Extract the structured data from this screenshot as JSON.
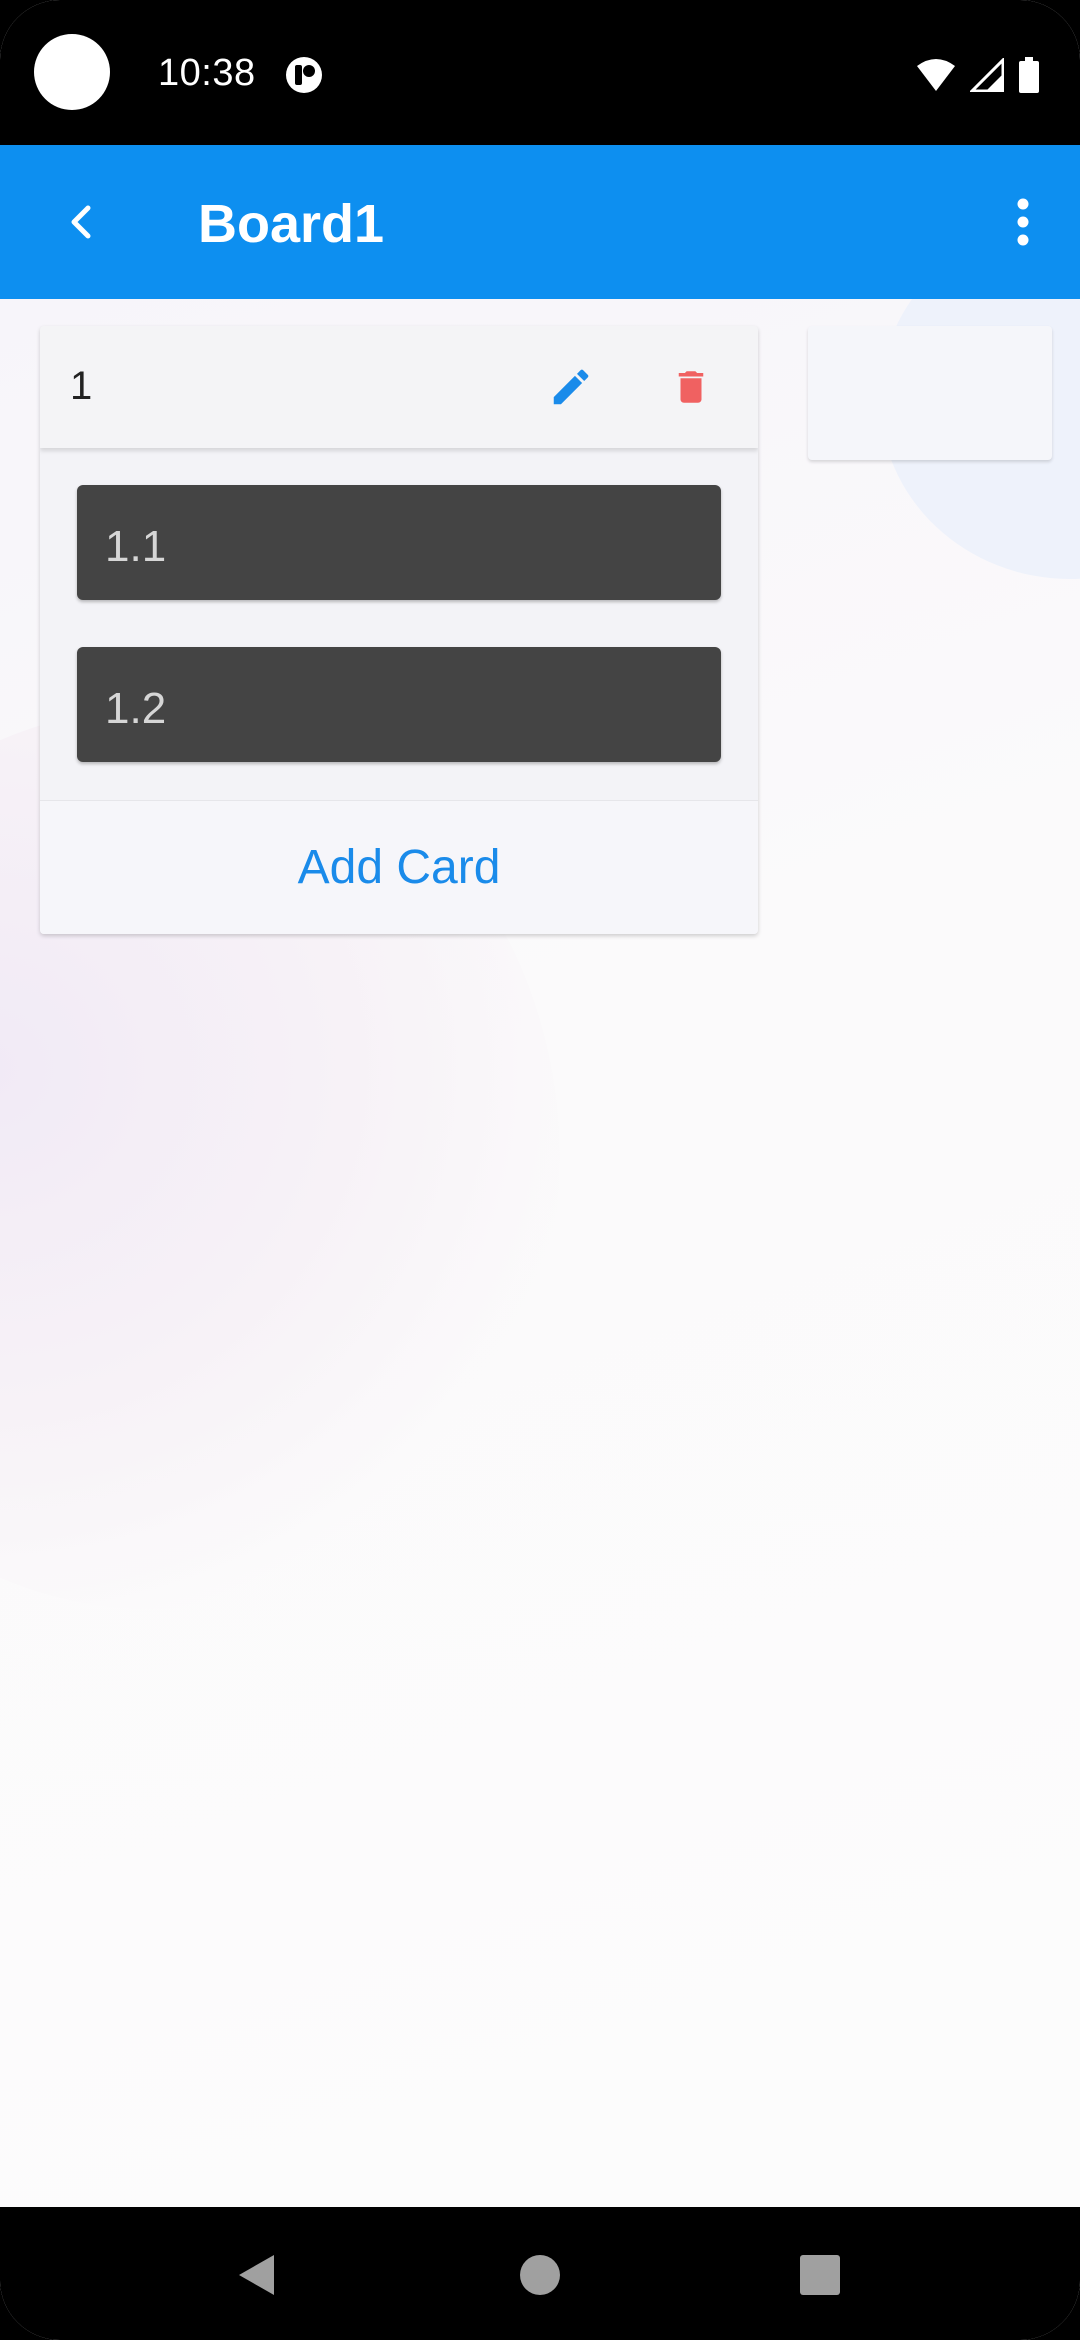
{
  "status_bar": {
    "time": "10:38",
    "icons": [
      "wifi-icon",
      "signal-icon",
      "battery-icon",
      "notification-icon"
    ]
  },
  "app_bar": {
    "title": "Board1",
    "background": "#0d8ff0",
    "back_icon": "chevron-left-icon",
    "menu_icon": "more-vert-icon"
  },
  "board": {
    "lists": [
      {
        "title": "1",
        "edit_icon": "pencil-icon",
        "delete_icon": "trash-icon",
        "cards": [
          {
            "label": "1.1"
          },
          {
            "label": "1.2"
          }
        ],
        "add_card_label": "Add Card"
      }
    ]
  },
  "colors": {
    "accent": "#1a8bea",
    "delete": "#f06161",
    "card": "#444444"
  },
  "nav_bar": {
    "buttons": [
      "back-triangle-icon",
      "home-circle-icon",
      "recents-square-icon"
    ]
  }
}
